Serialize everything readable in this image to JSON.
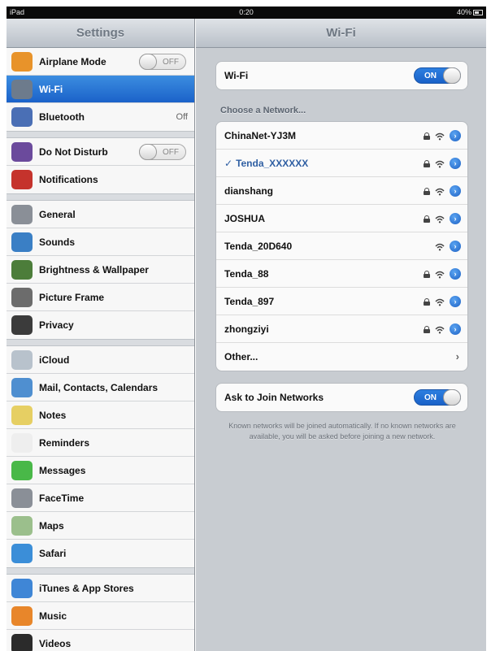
{
  "statusbar": {
    "device": "iPad",
    "time": "0:20",
    "battery": "40%"
  },
  "sidebar": {
    "title": "Settings",
    "groups": [
      {
        "items": [
          {
            "label": "Airplane Mode",
            "toggle": "OFF",
            "icon": "airplane-icon",
            "color": "#e8932a"
          },
          {
            "label": "Wi-Fi",
            "icon": "wifi-icon",
            "color": "#6d7b8c",
            "selected": true
          },
          {
            "label": "Bluetooth",
            "value": "Off",
            "icon": "bluetooth-icon",
            "color": "#4a6fb5"
          }
        ]
      },
      {
        "items": [
          {
            "label": "Do Not Disturb",
            "toggle": "OFF",
            "icon": "moon-icon",
            "color": "#6b4a9c"
          },
          {
            "label": "Notifications",
            "icon": "notifications-icon",
            "color": "#c5332c"
          }
        ]
      },
      {
        "items": [
          {
            "label": "General",
            "icon": "gear-icon",
            "color": "#8a8f97"
          },
          {
            "label": "Sounds",
            "icon": "speaker-icon",
            "color": "#3a7fc5"
          },
          {
            "label": "Brightness & Wallpaper",
            "icon": "flower-icon",
            "color": "#4c7d3a"
          },
          {
            "label": "Picture Frame",
            "icon": "picture-frame-icon",
            "color": "#6c6c6c"
          },
          {
            "label": "Privacy",
            "icon": "hand-icon",
            "color": "#3b3b3b"
          }
        ]
      },
      {
        "items": [
          {
            "label": "iCloud",
            "icon": "cloud-icon",
            "color": "#b8c2cc"
          },
          {
            "label": "Mail, Contacts, Calendars",
            "icon": "mail-icon",
            "color": "#4f8fd0"
          },
          {
            "label": "Notes",
            "icon": "notes-icon",
            "color": "#e6cf63"
          },
          {
            "label": "Reminders",
            "icon": "reminders-icon",
            "color": "#eeeeee"
          },
          {
            "label": "Messages",
            "icon": "messages-icon",
            "color": "#49b848"
          },
          {
            "label": "FaceTime",
            "icon": "facetime-icon",
            "color": "#8a8f97"
          },
          {
            "label": "Maps",
            "icon": "maps-icon",
            "color": "#9bbf8c"
          },
          {
            "label": "Safari",
            "icon": "compass-icon",
            "color": "#3b8ed8"
          }
        ]
      },
      {
        "items": [
          {
            "label": "iTunes & App Stores",
            "icon": "app-store-icon",
            "color": "#3f86d6"
          },
          {
            "label": "Music",
            "icon": "music-icon",
            "color": "#e8862a"
          },
          {
            "label": "Videos",
            "icon": "video-icon",
            "color": "#2b2b2b"
          }
        ]
      }
    ]
  },
  "detail": {
    "title": "Wi-Fi",
    "wifi_row": {
      "label": "Wi-Fi",
      "toggle": "ON"
    },
    "section_title": "Choose a Network...",
    "networks": [
      {
        "name": "ChinaNet-YJ3M",
        "locked": true
      },
      {
        "name": "Tenda_XXXXXX",
        "locked": true,
        "connected": true
      },
      {
        "name": "dianshang",
        "locked": true
      },
      {
        "name": "JOSHUA",
        "locked": true
      },
      {
        "name": "Tenda_20D640",
        "locked": false
      },
      {
        "name": "Tenda_88",
        "locked": true
      },
      {
        "name": "Tenda_897",
        "locked": true
      },
      {
        "name": "zhongziyi",
        "locked": true
      }
    ],
    "other_label": "Other...",
    "ask_row": {
      "label": "Ask to Join Networks",
      "toggle": "ON"
    },
    "footer_text": "Known networks will be joined automatically. If no known networks are available, you will be asked before joining a new network.",
    "check_mark": "✓",
    "info_glyph": "›",
    "chevron_glyph": "›",
    "accent_color": "#1f62c4"
  }
}
